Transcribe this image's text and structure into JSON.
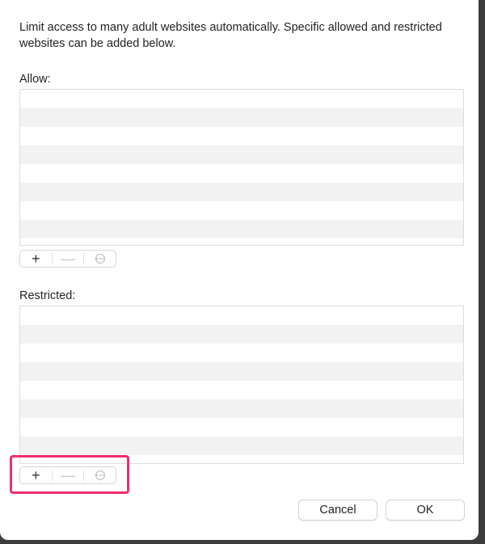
{
  "description": "Limit access to many adult websites automatically. Specific allowed and restricted websites can be added below.",
  "allow": {
    "label": "Allow:",
    "items": [],
    "toolbar": {
      "add": "+",
      "remove": "—",
      "more_icon": "ellipsis-circle-icon"
    }
  },
  "restricted": {
    "label": "Restricted:",
    "items": [],
    "toolbar": {
      "add": "+",
      "remove": "—",
      "more_icon": "ellipsis-circle-icon"
    }
  },
  "buttons": {
    "cancel": "Cancel",
    "ok": "OK"
  },
  "colors": {
    "highlight": "#ee2f6b",
    "row_alt": "#f2f2f2"
  }
}
